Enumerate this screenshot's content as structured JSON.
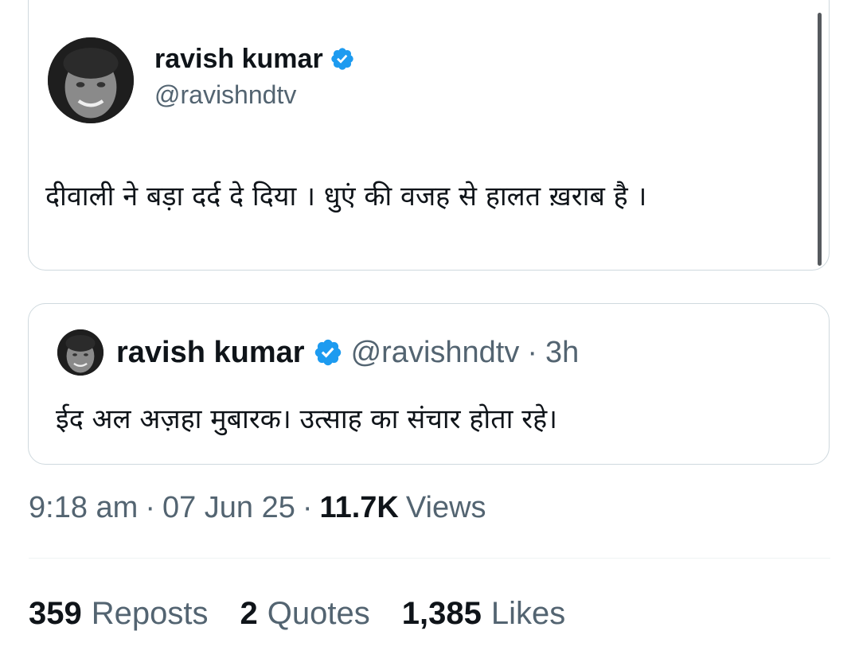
{
  "tweet": {
    "author_name": "ravish kumar",
    "author_handle": "@ravishndtv",
    "text": "दीवाली ने बड़ा दर्द दे दिया । धुएं की वजह से हालत ख़राब है ।"
  },
  "quoted_tweet": {
    "author_name": "ravish kumar",
    "author_handle": "@ravishndtv",
    "separator": "·",
    "time": "3h",
    "text": "ईद अल अज़हा मुबारक। उत्साह का संचार होता रहे।"
  },
  "meta": {
    "time": "9:18 am",
    "separator_1": "·",
    "date": "07 Jun 25",
    "separator_2": "·",
    "views_count": "11.7K",
    "views_label": "Views"
  },
  "stats": {
    "reposts_count": "359",
    "reposts_label": "Reposts",
    "quotes_count": "2",
    "quotes_label": "Quotes",
    "likes_count": "1,385",
    "likes_label": "Likes"
  },
  "colors": {
    "verified": "#1d9bf0",
    "secondary_text": "#536471",
    "border": "#cfd9de"
  },
  "icons": {
    "verified": "verified-badge-icon"
  }
}
